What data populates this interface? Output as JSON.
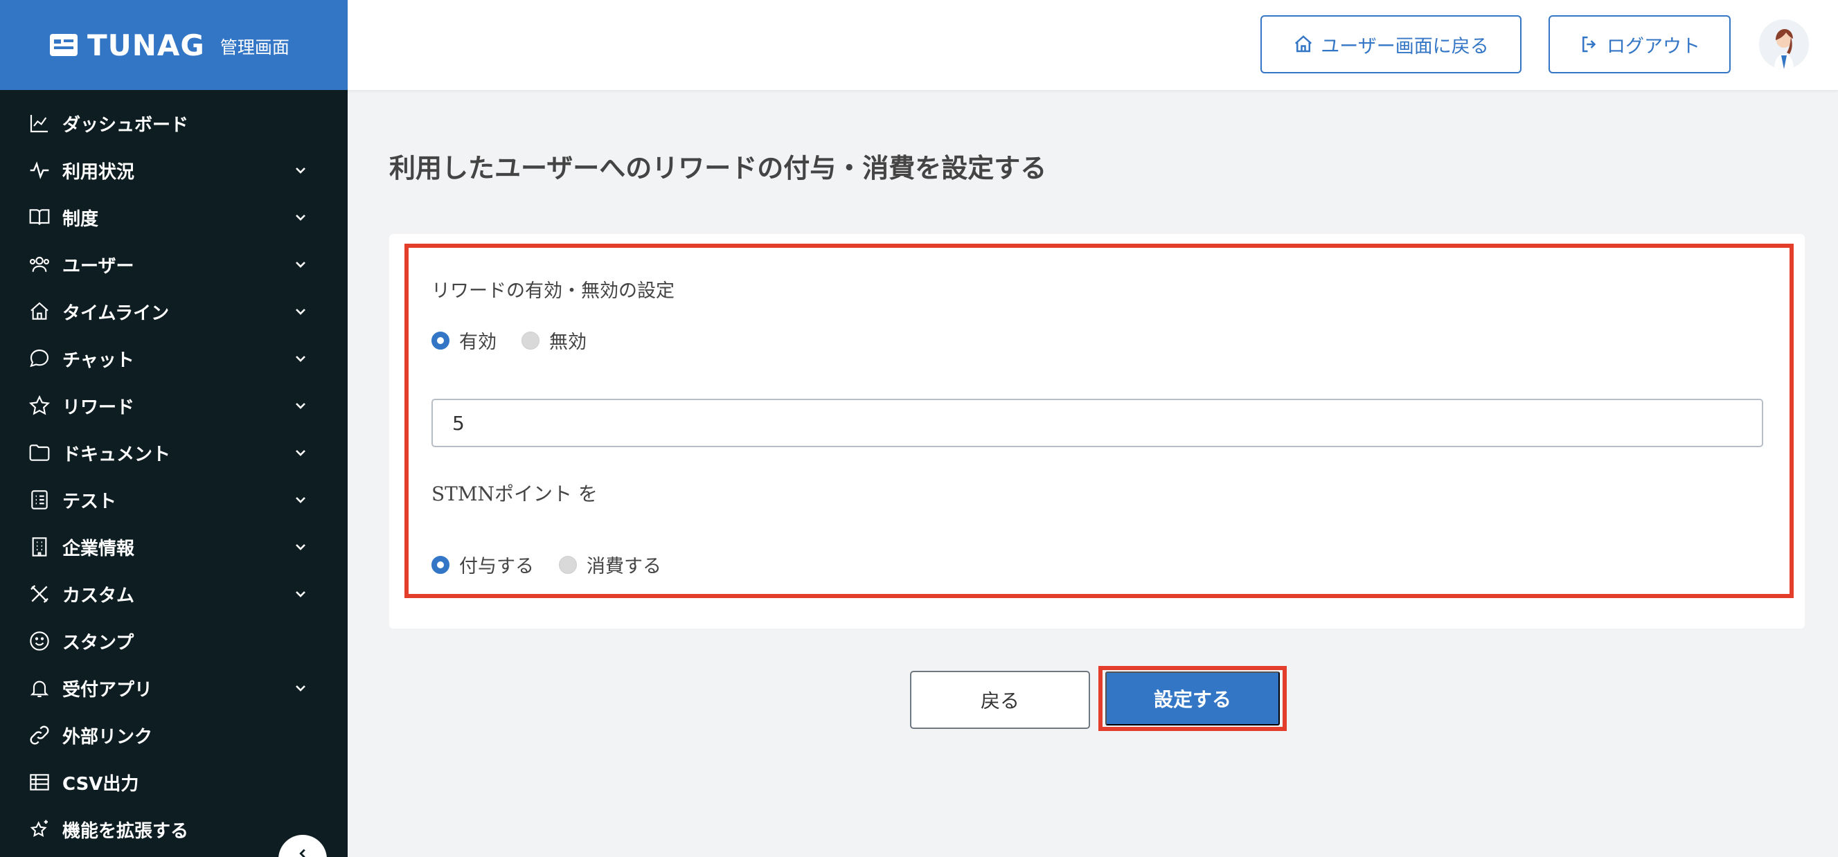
{
  "brand": {
    "logo_text": "TUNAG",
    "admin_label": "管理画面"
  },
  "sidebar": {
    "items": [
      {
        "label": "ダッシュボード",
        "icon": "chart-line-icon",
        "expandable": false
      },
      {
        "label": "利用状況",
        "icon": "activity-icon",
        "expandable": true
      },
      {
        "label": "制度",
        "icon": "book-icon",
        "expandable": true
      },
      {
        "label": "ユーザー",
        "icon": "users-icon",
        "expandable": true
      },
      {
        "label": "タイムライン",
        "icon": "home-icon",
        "expandable": true
      },
      {
        "label": "チャット",
        "icon": "chat-bubble-icon",
        "expandable": true
      },
      {
        "label": "リワード",
        "icon": "star-icon",
        "expandable": true
      },
      {
        "label": "ドキュメント",
        "icon": "folder-icon",
        "expandable": true
      },
      {
        "label": "テスト",
        "icon": "checklist-icon",
        "expandable": true
      },
      {
        "label": "企業情報",
        "icon": "building-icon",
        "expandable": true
      },
      {
        "label": "カスタム",
        "icon": "tools-icon",
        "expandable": true
      },
      {
        "label": "スタンプ",
        "icon": "smile-icon",
        "expandable": false
      },
      {
        "label": "受付アプリ",
        "icon": "bell-icon",
        "expandable": true
      },
      {
        "label": "外部リンク",
        "icon": "link-icon",
        "expandable": false
      },
      {
        "label": "CSV出力",
        "icon": "table-icon",
        "expandable": false
      },
      {
        "label": "機能を拡張する",
        "icon": "sparkle-star-icon",
        "expandable": false
      }
    ]
  },
  "header": {
    "user_screen_label": "ユーザー画面に戻る",
    "logout_label": "ログアウト"
  },
  "main": {
    "title": "利用したユーザーへのリワードの付与・消費を設定する",
    "reward_setting_label": "リワードの有効・無効の設定",
    "enable_options": [
      {
        "label": "有効",
        "selected": true
      },
      {
        "label": "無効",
        "selected": false
      }
    ],
    "amount_value": "5",
    "point_label": "STMNポイント を",
    "action_options": [
      {
        "label": "付与する",
        "selected": true
      },
      {
        "label": "消費する",
        "selected": false
      }
    ],
    "back_label": "戻る",
    "submit_label": "設定する"
  },
  "colors": {
    "accent": "#3476c6",
    "sidebar_bg": "#0d1d22",
    "highlight": "#e23e2b"
  }
}
